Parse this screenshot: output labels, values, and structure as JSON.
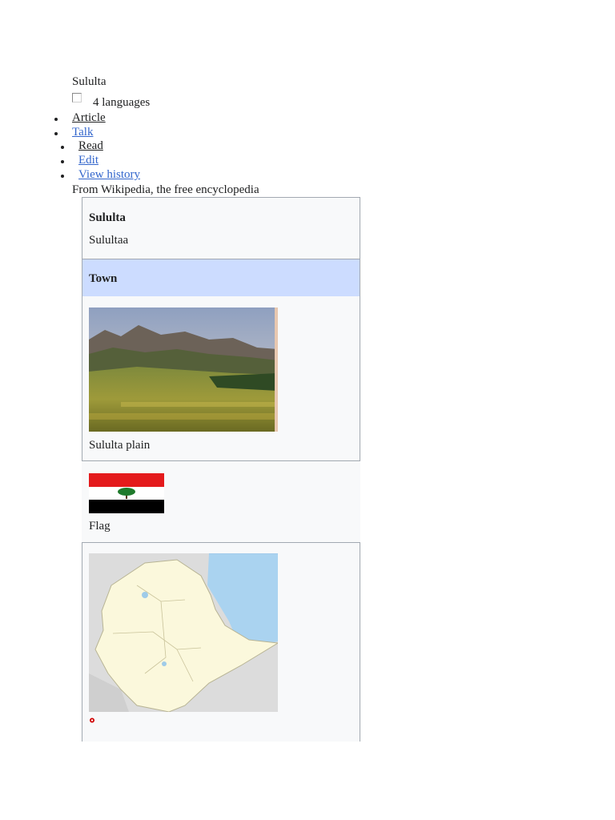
{
  "page": {
    "title": "Sululta",
    "languages_label": "4 languages",
    "tagline": "From Wikipedia, the free encyclopedia"
  },
  "tabs": {
    "namespaces": [
      {
        "label": "Article",
        "current": true
      },
      {
        "label": "Talk",
        "current": false
      }
    ],
    "views": [
      {
        "label": "Read",
        "current": true
      },
      {
        "label": "Edit",
        "current": false
      },
      {
        "label": "View history",
        "current": false
      }
    ]
  },
  "infobox": {
    "name": "Sululta",
    "native_name": "Sulultaa",
    "settlement_type": "Town",
    "image_caption": "Sululta plain",
    "flag_caption": "Flag"
  },
  "colors": {
    "link": "#3366cc",
    "text": "#202122",
    "infobox_bg": "#f8f9fa",
    "infobox_border": "#a2a9b1",
    "header_band": "#ccdcff",
    "flag_red": "#e41a1c",
    "flag_white": "#ffffff",
    "flag_black": "#000000",
    "flag_tree": "#1f7a2c"
  }
}
